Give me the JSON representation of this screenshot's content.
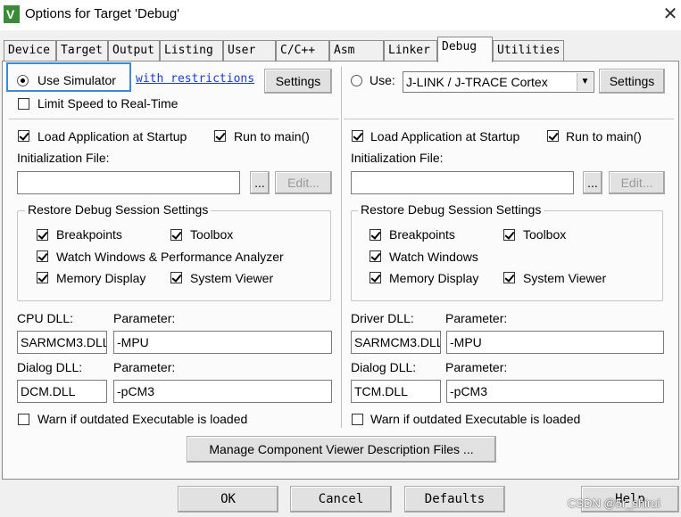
{
  "window": {
    "title": "Options for Target 'Debug'",
    "close_glyph": "✕"
  },
  "tabs": [
    {
      "label": "Device"
    },
    {
      "label": "Target"
    },
    {
      "label": "Output"
    },
    {
      "label": "Listing"
    },
    {
      "label": "User"
    },
    {
      "label": "C/C++"
    },
    {
      "label": "Asm"
    },
    {
      "label": "Linker"
    },
    {
      "label": "Debug"
    },
    {
      "label": "Utilities"
    }
  ],
  "active_tab": "Debug",
  "left": {
    "use_simulator": "Use Simulator",
    "with_restrictions": "with restrictions",
    "settings": "Settings",
    "limit_speed": "Limit Speed to Real-Time",
    "load_app": "Load Application at Startup",
    "run_to_main": "Run to main()",
    "init_file_label": "Initialization File:",
    "init_file_value": "",
    "browse": "...",
    "edit": "Edit...",
    "restore_group": "Restore Debug Session Settings",
    "breakpoints": "Breakpoints",
    "toolbox": "Toolbox",
    "watch_windows": "Watch Windows & Performance Analyzer",
    "memory_display": "Memory Display",
    "system_viewer": "System Viewer",
    "cpu_dll_label": "CPU DLL:",
    "cpu_param_label": "Parameter:",
    "cpu_dll": "SARMCM3.DLL",
    "cpu_param": " -MPU",
    "dialog_dll_label": "Dialog DLL:",
    "dialog_param_label": "Parameter:",
    "dialog_dll": "DCM.DLL",
    "dialog_param": "-pCM3",
    "warn_outdated": "Warn if outdated Executable is loaded"
  },
  "right": {
    "use": "Use:",
    "driver_select": "J-LINK / J-TRACE Cortex",
    "settings": "Settings",
    "load_app": "Load Application at Startup",
    "run_to_main": "Run to main()",
    "init_file_label": "Initialization File:",
    "init_file_value": "",
    "browse": "...",
    "edit": "Edit...",
    "restore_group": "Restore Debug Session Settings",
    "breakpoints": "Breakpoints",
    "toolbox": "Toolbox",
    "watch_windows": "Watch Windows",
    "memory_display": "Memory Display",
    "system_viewer": "System Viewer",
    "driver_dll_label": "Driver DLL:",
    "driver_param_label": "Parameter:",
    "driver_dll": "SARMCM3.DLL",
    "driver_param": "-MPU",
    "dialog_dll_label": "Dialog DLL:",
    "dialog_param_label": "Parameter:",
    "dialog_dll": "TCM.DLL",
    "dialog_param": "-pCM3",
    "warn_outdated": "Warn if outdated Executable is loaded"
  },
  "manage_button": "Manage Component Viewer Description Files ...",
  "footer": {
    "ok": "OK",
    "cancel": "Cancel",
    "defaults": "Defaults",
    "help": "Help"
  },
  "watermark": "CSDN @5r_shirui",
  "colors": {
    "highlight": "#3a8ad6",
    "link": "#1a3ccf",
    "app_icon": "#3a8a3a"
  }
}
